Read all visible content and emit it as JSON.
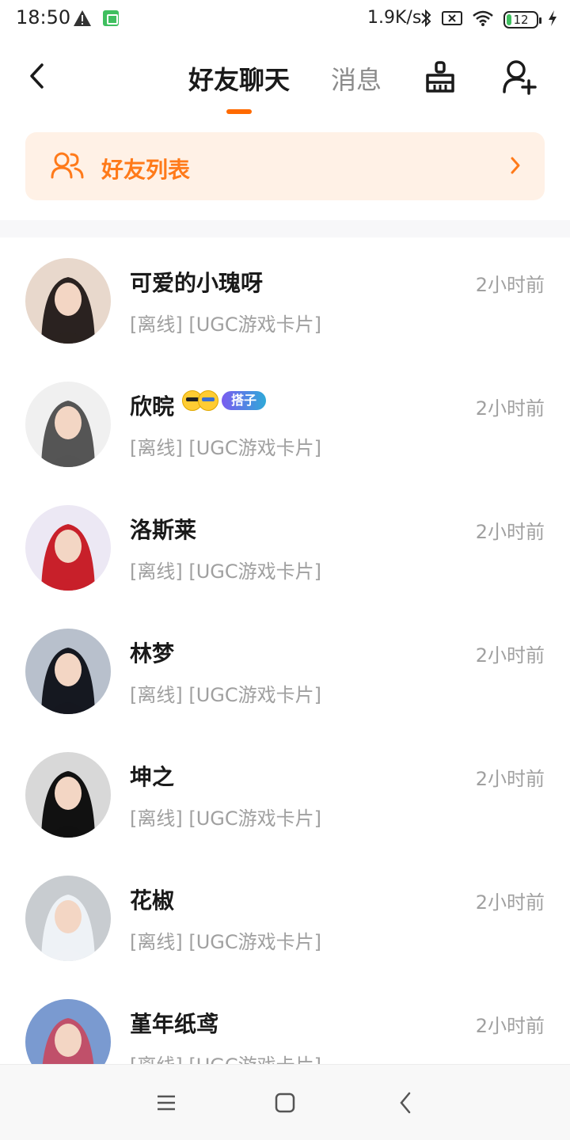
{
  "status_bar": {
    "time": "18:50",
    "network_speed": "1.9K/s",
    "battery": "12",
    "icons": [
      "warning-icon",
      "app-notification-icon",
      "bluetooth-icon",
      "no-sim-icon",
      "wifi-icon",
      "battery-icon",
      "charging-icon"
    ]
  },
  "header": {
    "tab_friends": "好友聊天",
    "tab_messages": "消息",
    "active_tab": "好友聊天"
  },
  "banner": {
    "label": "好友列表"
  },
  "conversations": [
    {
      "name": "可爱的小瑰呀",
      "preview": "[离线] [UGC游戏卡片]",
      "time": "2小时前",
      "avatar_colors": [
        "#e8d8cc",
        "#2a2220"
      ]
    },
    {
      "name": "欣晥",
      "preview": "[离线] [UGC游戏卡片]",
      "time": "2小时前",
      "badge": "搭子",
      "avatar_colors": [
        "#f0f0f0",
        "#555555"
      ]
    },
    {
      "name": "洛斯莱",
      "preview": "[离线] [UGC游戏卡片]",
      "time": "2小时前",
      "avatar_colors": [
        "#ece8f4",
        "#c8202a"
      ]
    },
    {
      "name": "林梦",
      "preview": "[离线] [UGC游戏卡片]",
      "time": "2小时前",
      "avatar_colors": [
        "#b8c0cc",
        "#151820"
      ]
    },
    {
      "name": "坤之",
      "preview": "[离线] [UGC游戏卡片]",
      "time": "2小时前",
      "avatar_colors": [
        "#d8d8d8",
        "#111111"
      ]
    },
    {
      "name": "花椒",
      "preview": "[离线] [UGC游戏卡片]",
      "time": "2小时前",
      "avatar_colors": [
        "#c8ccd0",
        "#eef2f6"
      ]
    },
    {
      "name": "堇年纸鸢",
      "preview": "[离线] [UGC游戏卡片]",
      "time": "2小时前",
      "avatar_colors": [
        "#7a9ad0",
        "#c0506a"
      ]
    }
  ],
  "colors": {
    "accent": "#ff6a00",
    "banner_bg": "#fff1e6",
    "banner_text": "#ff7a1a"
  }
}
